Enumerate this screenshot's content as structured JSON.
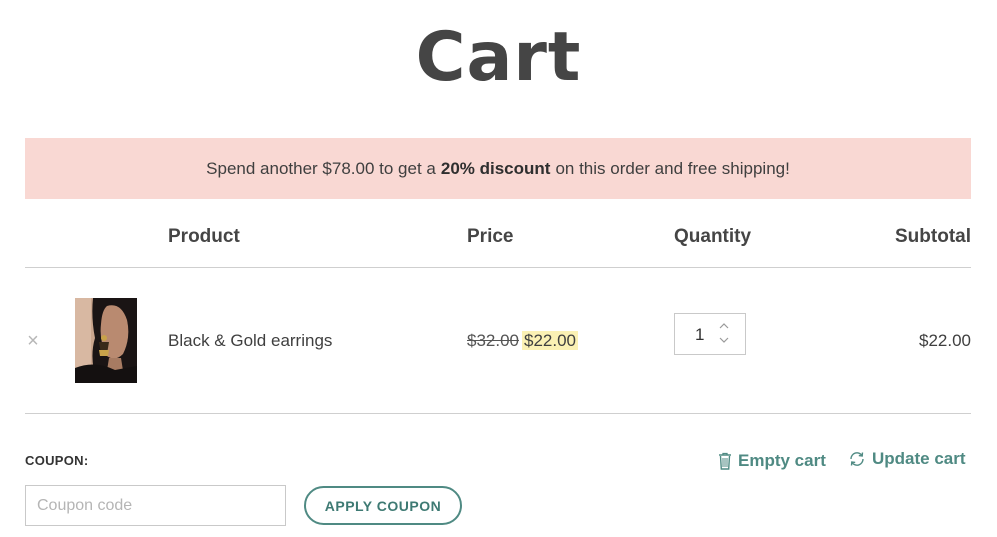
{
  "page": {
    "title": "Cart"
  },
  "notice": {
    "prefix": "Spend another $78.00 to get a",
    "highlight": "20% discount",
    "suffix": "on this order and free shipping!"
  },
  "table": {
    "headers": {
      "product": "Product",
      "price": "Price",
      "quantity": "Quantity",
      "subtotal": "Subtotal"
    },
    "rows": [
      {
        "remove_symbol": "×",
        "product_name": "Black & Gold earrings",
        "price_old": "$32.00",
        "price_new": "$22.00",
        "quantity": "1",
        "subtotal": "$22.00"
      }
    ]
  },
  "coupon": {
    "label": "COUPON:",
    "placeholder": "Coupon code",
    "apply_label": "APPLY COUPON"
  },
  "actions": {
    "empty_cart": "Empty cart",
    "update_cart": "Update cart"
  },
  "colors": {
    "accent": "#4f8a83",
    "notice_bg": "#f9d8d3",
    "sale_highlight": "#fbf1b4"
  },
  "icons": {
    "remove": "close-icon",
    "empty_cart": "trash-icon",
    "update_cart": "refresh-icon"
  }
}
